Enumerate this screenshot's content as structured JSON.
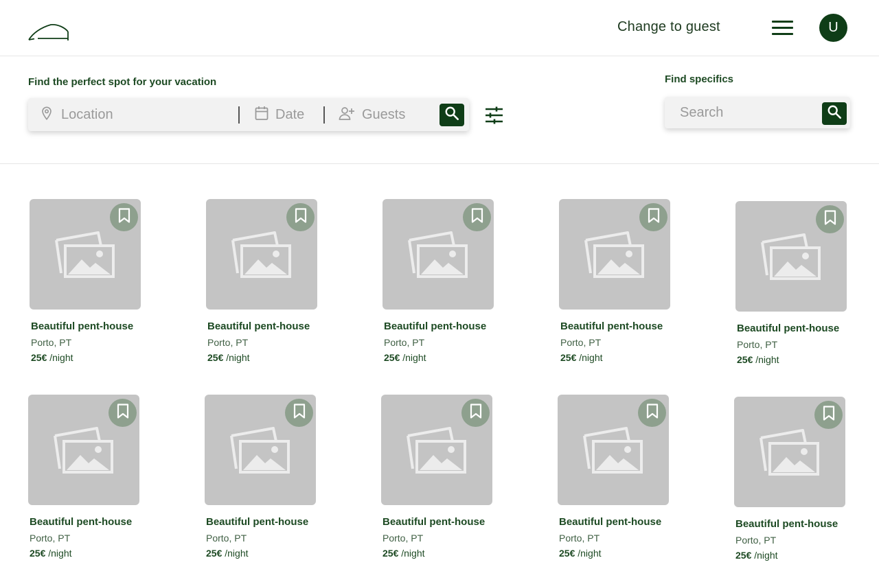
{
  "header": {
    "change_guest": "Change to guest",
    "avatar_initial": "U"
  },
  "search": {
    "caption": "Find the perfect spot for your vacation",
    "location_placeholder": "Location",
    "date_placeholder": "Date",
    "guests_placeholder": "Guests"
  },
  "specifics": {
    "caption": "Find specifics",
    "placeholder": "Search"
  },
  "colors": {
    "brand_dark": "#0f3d17",
    "text_green": "#1d4a23",
    "thumb_gray": "#c4c4c4",
    "bookmark_bg": "#8ea08e"
  },
  "icons": [
    "logo-icon",
    "menu-icon",
    "location-icon",
    "calendar-icon",
    "add-user-icon",
    "search-icon",
    "filter-icon",
    "bookmark-icon",
    "image-placeholder-icon"
  ],
  "listings": [
    {
      "title": "Beautiful pent-house",
      "location": "Porto, PT",
      "price": "25€",
      "unit": "/night"
    },
    {
      "title": "Beautiful pent-house",
      "location": "Porto, PT",
      "price": "25€",
      "unit": "/night"
    },
    {
      "title": "Beautiful pent-house",
      "location": "Porto, PT",
      "price": "25€",
      "unit": "/night"
    },
    {
      "title": "Beautiful pent-house",
      "location": "Porto, PT",
      "price": "25€",
      "unit": "/night"
    },
    {
      "title": "Beautiful pent-house",
      "location": "Porto, PT",
      "price": "25€",
      "unit": "/night"
    },
    {
      "title": "Beautiful pent-house",
      "location": "Porto, PT",
      "price": "25€",
      "unit": "/night"
    },
    {
      "title": "Beautiful pent-house",
      "location": "Porto, PT",
      "price": "25€",
      "unit": "/night"
    },
    {
      "title": "Beautiful pent-house",
      "location": "Porto, PT",
      "price": "25€",
      "unit": "/night"
    },
    {
      "title": "Beautiful pent-house",
      "location": "Porto, PT",
      "price": "25€",
      "unit": "/night"
    },
    {
      "title": "Beautiful pent-house",
      "location": "Porto, PT",
      "price": "25€",
      "unit": "/night"
    }
  ]
}
